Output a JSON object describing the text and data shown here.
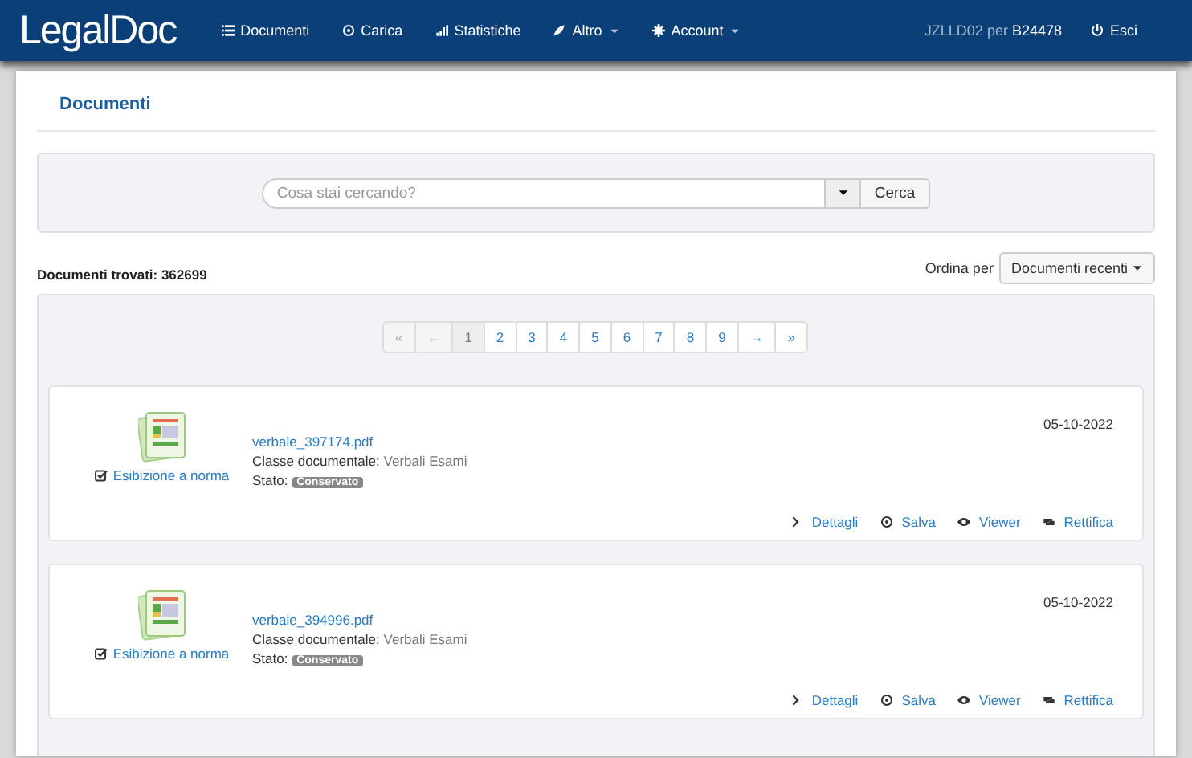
{
  "navbar": {
    "brand": "LegalDoc",
    "items": [
      {
        "label": "Documenti",
        "dropdown": false
      },
      {
        "label": "Carica",
        "dropdown": false
      },
      {
        "label": "Statistiche",
        "dropdown": false
      },
      {
        "label": "Altro",
        "dropdown": true
      },
      {
        "label": "Account",
        "dropdown": true
      }
    ],
    "user": "JZLLD02",
    "user_prefix": "per",
    "user_org": "B24478",
    "logout": "Esci"
  },
  "page_title": "Documenti",
  "search": {
    "placeholder": "Cosa stai cercando?",
    "button": "Cerca"
  },
  "results": {
    "label": "Documenti trovati:",
    "count": "362699"
  },
  "sort": {
    "label": "Ordina per",
    "value": "Documenti recenti"
  },
  "pagination": [
    {
      "label": "«",
      "disabled": true,
      "selected": false
    },
    {
      "label": "←",
      "disabled": true,
      "selected": false
    },
    {
      "label": "1",
      "disabled": false,
      "selected": true
    },
    {
      "label": "2",
      "disabled": false,
      "selected": false
    },
    {
      "label": "3",
      "disabled": false,
      "selected": false
    },
    {
      "label": "4",
      "disabled": false,
      "selected": false
    },
    {
      "label": "5",
      "disabled": false,
      "selected": false
    },
    {
      "label": "6",
      "disabled": false,
      "selected": false
    },
    {
      "label": "7",
      "disabled": false,
      "selected": false
    },
    {
      "label": "8",
      "disabled": false,
      "selected": false
    },
    {
      "label": "9",
      "disabled": false,
      "selected": false
    },
    {
      "label": "→",
      "disabled": false,
      "selected": false
    },
    {
      "label": "»",
      "disabled": false,
      "selected": false
    }
  ],
  "documents": [
    {
      "filename": "verbale_397174.pdf",
      "class_label": "Classe documentale:",
      "class_value": "Verbali Esami",
      "state_label": "Stato:",
      "state": "Conservato",
      "date": "05-10-2022",
      "compliance": "Esibizione a norma",
      "actions": [
        "Dettagli",
        "Salva",
        "Viewer",
        "Rettifica"
      ]
    },
    {
      "filename": "verbale_394996.pdf",
      "class_label": "Classe documentale:",
      "class_value": "Verbali Esami",
      "state_label": "Stato:",
      "state": "Conservato",
      "date": "05-10-2022",
      "compliance": "Esibizione a norma",
      "actions": [
        "Dettagli",
        "Salva",
        "Viewer",
        "Rettifica"
      ]
    }
  ]
}
